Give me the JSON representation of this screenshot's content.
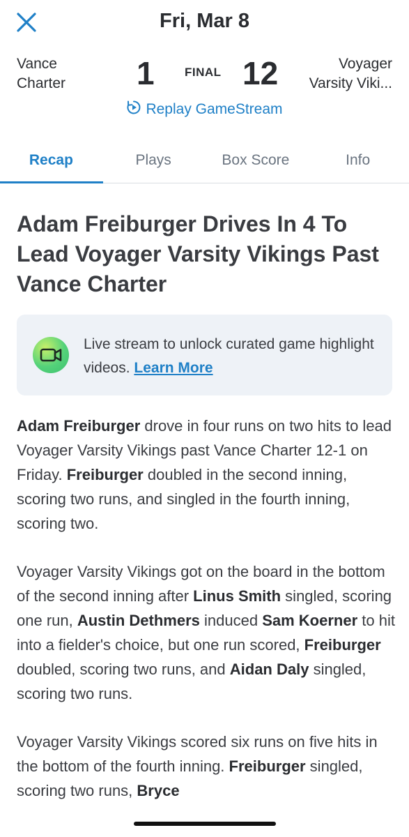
{
  "header": {
    "date": "Fri, Mar 8",
    "close_icon": "close-icon"
  },
  "score": {
    "away_team_line1": "Vance",
    "away_team_line2": "Charter",
    "away_runs": "1",
    "status": "FINAL",
    "home_runs": "12",
    "home_team_line1": "Voyager",
    "home_team_line2": "Varsity Viki..."
  },
  "replay": {
    "label": "Replay GameStream",
    "icon": "replay-icon"
  },
  "tabs": [
    {
      "label": "Recap",
      "active": true
    },
    {
      "label": "Plays",
      "active": false
    },
    {
      "label": "Box Score",
      "active": false
    },
    {
      "label": "Info",
      "active": false
    }
  ],
  "headline": "Adam Freiburger Drives In 4 To Lead Voyager Varsity Vikings Past Vance Charter",
  "promo": {
    "icon": "video-camera-icon",
    "text": "Live stream to unlock curated game highlight videos.",
    "link": "Learn More"
  },
  "article": {
    "p1": {
      "b1": "Adam Freiburger",
      "t1": " drove in four runs on two hits to lead Voyager Varsity Vikings past Vance Charter 12-1 on Friday. ",
      "b2": "Freiburger",
      "t2": " doubled in the second inning, scoring two runs, and singled in the fourth inning, scoring two."
    },
    "p2": {
      "t1": "Voyager Varsity Vikings got on the board in the bottom of the second inning after ",
      "b1": "Linus Smith",
      "t2": " singled, scoring one run, ",
      "b2": "Austin Dethmers",
      "t3": " induced ",
      "b3": "Sam Koerner",
      "t4": " to hit into a fielder's choice, but one run scored, ",
      "b4": "Freiburger",
      "t5": " doubled, scoring two runs, and ",
      "b5": "Aidan Daly",
      "t6": " singled, scoring two runs."
    },
    "p3": {
      "t1": "Voyager Varsity Vikings scored six runs on five hits in the bottom of the fourth inning. ",
      "b1": "Freiburger",
      "t2": " singled, scoring two runs, ",
      "b2": "Bryce"
    }
  },
  "colors": {
    "accent": "#1f80c7",
    "text": "#2a2c30",
    "promo_bg": "#eef2f7"
  }
}
